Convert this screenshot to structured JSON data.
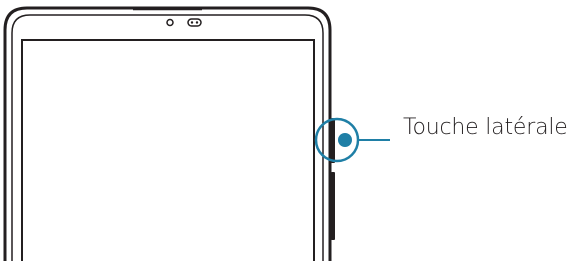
{
  "callout": {
    "label": "Touche latérale"
  },
  "colors": {
    "device_outline": "#231f20",
    "highlight_ring": "#1f7fa6",
    "highlight_dot": "#1f7fa6",
    "leader_line": "#1f7fa6",
    "label_text": "#231f20",
    "background": "#ffffff"
  },
  "icons": {
    "front_camera": "front-camera-icon",
    "sensor": "sensor-icon"
  }
}
